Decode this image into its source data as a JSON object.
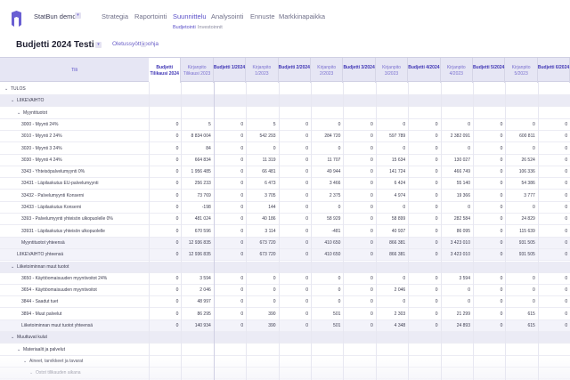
{
  "app": {
    "name": "StatBun demo",
    "menu_icon": "chevron-down-icon"
  },
  "nav": {
    "items": [
      "Strategia",
      "Raportointi",
      "Suunnittelu",
      "Analysointi",
      "Ennuste",
      "Markkinapaikka"
    ],
    "active": "Suunnittelu",
    "sub_items": [
      "Budjetointi",
      "Investoinnit"
    ],
    "sub_active": "Budjetointi"
  },
  "page": {
    "title": "Budjetti 2024 Testi",
    "template_label": "Oletussyöttöpohja"
  },
  "table": {
    "title_header": "Tili",
    "columns": [
      "Budjetti Tilikausi 2024",
      "Kirjanpito Tilikausi 2023",
      "Budjetti 1/2024",
      "Kirjanpito 1/2023",
      "Budjetti 2/2024",
      "Kirjanpito 2/2023",
      "Budjetti 3/2024",
      "Kirjanpito 3/2023",
      "Budjetti 4/2024",
      "Kirjanpito 4/2023",
      "Budjetti 5/2024",
      "Kirjanpito 5/2023",
      "Budjetti 6/2024"
    ],
    "rows": [
      {
        "label": "TULOS",
        "level": 0,
        "type": "group",
        "chevron": "v",
        "values": []
      },
      {
        "label": "LIIKEVAIHTO",
        "level": 1,
        "type": "section",
        "chevron": "v",
        "values": []
      },
      {
        "label": "Myyntituotot",
        "level": 2,
        "type": "group",
        "chevron": "v",
        "values": []
      },
      {
        "label": "3000 - Myynti 24%",
        "level": 3,
        "type": "account",
        "values": [
          "0",
          "5",
          "0",
          "5",
          "0",
          "0",
          "0",
          "0",
          "0",
          "0",
          "0",
          "0",
          "0"
        ]
      },
      {
        "label": "3010 - Myynti 2 24%",
        "level": 3,
        "type": "account",
        "values": [
          "0",
          "8 834 004",
          "0",
          "542 293",
          "0",
          "284 720",
          "0",
          "597 789",
          "0",
          "2 382 091",
          "0",
          "600 811",
          "0"
        ]
      },
      {
        "label": "3020 - Myynti 3 24%",
        "level": 3,
        "type": "account",
        "values": [
          "0",
          "84",
          "0",
          "0",
          "0",
          "0",
          "0",
          "0",
          "0",
          "0",
          "0",
          "0",
          "0"
        ]
      },
      {
        "label": "3030 - Myynti 4 24%",
        "level": 3,
        "type": "account",
        "values": [
          "0",
          "664 834",
          "0",
          "11 319",
          "0",
          "11 707",
          "0",
          "15 634",
          "0",
          "130 027",
          "0",
          "26 524",
          "0"
        ]
      },
      {
        "label": "3343 - Yhteisöpalvelumyynti 0%",
        "level": 3,
        "type": "account",
        "values": [
          "0",
          "1 956 485",
          "0",
          "66 481",
          "0",
          "49 944",
          "0",
          "141 724",
          "0",
          "466 749",
          "0",
          "106 336",
          "0"
        ]
      },
      {
        "label": "33431 - Läpilaskutus EU-palvelumyynti",
        "level": 3,
        "type": "account",
        "values": [
          "0",
          "256 233",
          "0",
          "6 473",
          "0",
          "3 466",
          "0",
          "6 424",
          "0",
          "55 140",
          "0",
          "54 386",
          "0"
        ]
      },
      {
        "label": "33432 - Palvelumyynti Konserni",
        "level": 3,
        "type": "account",
        "values": [
          "0",
          "73 769",
          "0",
          "3 705",
          "0",
          "2 375",
          "0",
          "4 974",
          "0",
          "19 366",
          "0",
          "3 777",
          "0"
        ]
      },
      {
        "label": "33433 - Läpilaskutus Konserni",
        "level": 3,
        "type": "account",
        "values": [
          "0",
          "-198",
          "0",
          "144",
          "0",
          "0",
          "0",
          "0",
          "0",
          "0",
          "0",
          "0",
          "0"
        ]
      },
      {
        "label": "3393 - Palvelumyynti yhteisön ulkopuolelle 0%",
        "level": 3,
        "type": "account",
        "values": [
          "0",
          "481 024",
          "0",
          "40 186",
          "0",
          "58 929",
          "0",
          "58 899",
          "0",
          "282 584",
          "0",
          "24 829",
          "0"
        ]
      },
      {
        "label": "33931 - Läpilaskutus yhteisön ulkopuolelle",
        "level": 3,
        "type": "account",
        "values": [
          "0",
          "670 596",
          "0",
          "3 114",
          "0",
          "-481",
          "0",
          "40 937",
          "0",
          "86 095",
          "0",
          "115 639",
          "0"
        ]
      },
      {
        "label": "Myyntituotot yhteensä",
        "level": 2,
        "type": "total",
        "values": [
          "0",
          "12 936 835",
          "0",
          "673 720",
          "0",
          "410 650",
          "0",
          "866 381",
          "0",
          "3 423 010",
          "0",
          "931 505",
          "0"
        ]
      },
      {
        "label": "LIIKEVAIHTO yhteensä",
        "level": 1,
        "type": "total",
        "values": [
          "0",
          "12 936 835",
          "0",
          "673 720",
          "0",
          "410 650",
          "0",
          "866 381",
          "0",
          "3 423 010",
          "0",
          "931 505",
          "0"
        ]
      },
      {
        "label": "Liiketoiminnan muut tuotot",
        "level": 1,
        "type": "section",
        "chevron": "v",
        "values": []
      },
      {
        "label": "3650 - Käyttöomaisuuden myyntivoitot 24%",
        "level": 3,
        "type": "account",
        "values": [
          "0",
          "3 594",
          "0",
          "0",
          "0",
          "0",
          "0",
          "0",
          "0",
          "3 594",
          "0",
          "0",
          "0"
        ]
      },
      {
        "label": "3654 - Käyttöomaisuuden myyntivoitot",
        "level": 3,
        "type": "account",
        "values": [
          "0",
          "2 046",
          "0",
          "0",
          "0",
          "0",
          "0",
          "2 046",
          "0",
          "0",
          "0",
          "0",
          "0"
        ]
      },
      {
        "label": "3844 - Saadut tuet",
        "level": 3,
        "type": "account",
        "values": [
          "0",
          "48 997",
          "0",
          "0",
          "0",
          "0",
          "0",
          "0",
          "0",
          "0",
          "0",
          "0",
          "0"
        ]
      },
      {
        "label": "3894 - Muut palvelut",
        "level": 3,
        "type": "account",
        "values": [
          "0",
          "86 295",
          "0",
          "390",
          "0",
          "501",
          "0",
          "2 303",
          "0",
          "21 299",
          "0",
          "615",
          "0"
        ]
      },
      {
        "label": "Liiketoiminnan muut tuotot yhteensä",
        "level": 2,
        "type": "total",
        "values": [
          "0",
          "140 934",
          "0",
          "390",
          "0",
          "501",
          "0",
          "4 348",
          "0",
          "24 893",
          "0",
          "615",
          "0"
        ]
      },
      {
        "label": "Muuttuvat kulut",
        "level": 1,
        "type": "section",
        "chevron": "v",
        "values": []
      },
      {
        "label": "Materiaalit ja palvelut",
        "level": 2,
        "type": "group",
        "chevron": "v",
        "values": []
      },
      {
        "label": "Aineet, tarvikkeet ja tavarat",
        "level": 3,
        "type": "group",
        "chevron": "v",
        "values": []
      },
      {
        "label": "Ostot tilikauden aikana",
        "level": 4,
        "type": "group",
        "chevron": "v",
        "values": []
      }
    ]
  }
}
